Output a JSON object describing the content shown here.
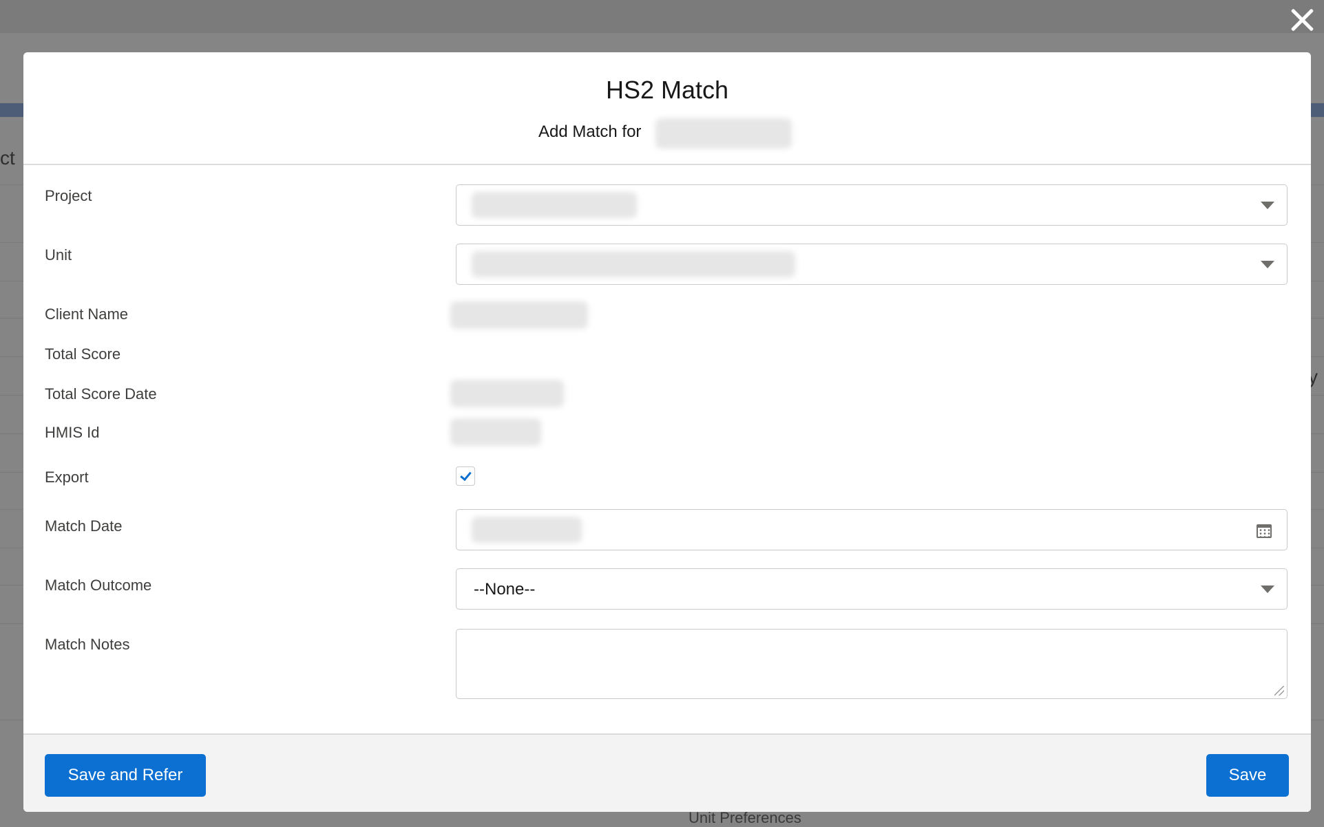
{
  "background": {
    "partial_left_text": "ct",
    "partial_right_text": "y",
    "footer_text": "Unit Preferences"
  },
  "modal": {
    "title": "HS2 Match",
    "subtitle": "Add Match for"
  },
  "form": {
    "project": {
      "label": "Project"
    },
    "unit": {
      "label": "Unit"
    },
    "client_name": {
      "label": "Client Name"
    },
    "total_score": {
      "label": "Total Score"
    },
    "total_score_date": {
      "label": "Total Score Date"
    },
    "hmis_id": {
      "label": "HMIS Id"
    },
    "export": {
      "label": "Export",
      "checked": true
    },
    "match_date": {
      "label": "Match Date"
    },
    "match_outcome": {
      "label": "Match Outcome",
      "value": "--None--"
    },
    "match_notes": {
      "label": "Match Notes",
      "value": ""
    }
  },
  "footer": {
    "save_and_refer_label": "Save and Refer",
    "save_label": "Save"
  },
  "colors": {
    "brand_button": "#0b70d1",
    "overlay": "#858585",
    "modal_bg": "#ffffff",
    "footer_bg": "#f3f3f3"
  },
  "icons": {
    "close": "close-icon",
    "dropdown": "chevron-down-icon",
    "calendar": "calendar-icon",
    "check": "checkmark-icon"
  }
}
